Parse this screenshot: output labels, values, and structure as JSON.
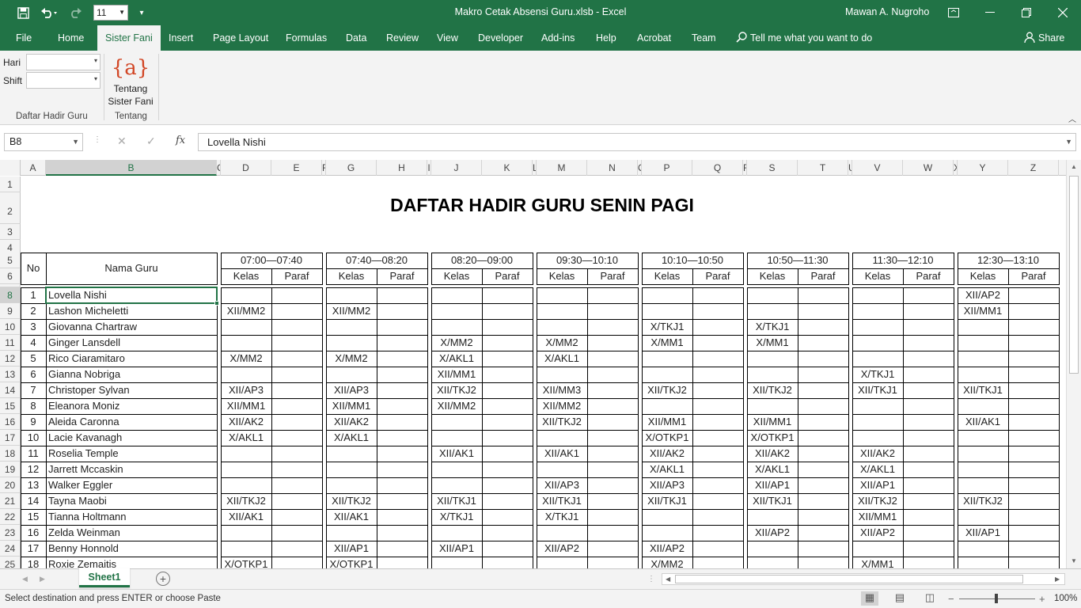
{
  "app": {
    "title": "Makro Cetak Absensi Guru.xlsb  -  Excel",
    "user": "Mawan A. Nugroho",
    "font_size": "11"
  },
  "tabs": [
    "File",
    "Home",
    "Sister Fani",
    "Insert",
    "Page Layout",
    "Formulas",
    "Data",
    "Review",
    "View",
    "Developer",
    "Add-ins",
    "Help",
    "Acrobat",
    "Team"
  ],
  "active_tab": "Sister Fani",
  "tell_me": "Tell me what you want to do",
  "share": "Share",
  "ribbon": {
    "hari_label": "Hari",
    "shift_label": "Shift",
    "group1_label": "Daftar Hadir Guru",
    "tentang_icon_text": "{a}",
    "tentang_btn_line1": "Tentang",
    "tentang_btn_line2": "Sister Fani",
    "group2_label": "Tentang"
  },
  "formula_bar": {
    "name_box": "B8",
    "fx": "fx",
    "content": "Lovella Nishi"
  },
  "columns": [
    "A",
    "B",
    "C",
    "D",
    "E",
    "F",
    "G",
    "H",
    "I",
    "J",
    "K",
    "L",
    "M",
    "N",
    "O",
    "P",
    "Q",
    "R",
    "S",
    "T",
    "U",
    "V",
    "W",
    "X",
    "Y",
    "Z"
  ],
  "selected_column": "B",
  "row_numbers": [
    "1",
    "2",
    "3",
    "4",
    "5",
    "6",
    "8",
    "9",
    "10",
    "11",
    "12",
    "13",
    "14",
    "15",
    "16",
    "17",
    "18",
    "19",
    "20",
    "21",
    "22",
    "23",
    "24",
    "25"
  ],
  "selected_row": "8",
  "sheet": {
    "title": "DAFTAR HADIR GURU SENIN PAGI",
    "header_no": "No",
    "header_nama": "Nama Guru",
    "time_slots": [
      "07:00—07:40",
      "07:40—08:20",
      "08:20—09:00",
      "09:30—10:10",
      "10:10—10:50",
      "10:50—11:30",
      "11:30—12:10",
      "12:30—13:10"
    ],
    "kelas_label": "Kelas",
    "paraf_label": "Paraf",
    "rows": [
      {
        "no": "1",
        "name": "Lovella Nishi",
        "kelas": [
          "",
          "",
          "",
          "",
          "",
          "",
          "",
          "XII/AP2"
        ]
      },
      {
        "no": "2",
        "name": "Lashon Micheletti",
        "kelas": [
          "XII/MM2",
          "XII/MM2",
          "",
          "",
          "",
          "",
          "",
          "XII/MM1"
        ]
      },
      {
        "no": "3",
        "name": "Giovanna Chartraw",
        "kelas": [
          "",
          "",
          "",
          "",
          "X/TKJ1",
          "X/TKJ1",
          "",
          ""
        ]
      },
      {
        "no": "4",
        "name": "Ginger Lansdell",
        "kelas": [
          "",
          "",
          "X/MM2",
          "X/MM2",
          "X/MM1",
          "X/MM1",
          "",
          ""
        ]
      },
      {
        "no": "5",
        "name": "Rico Ciaramitaro",
        "kelas": [
          "X/MM2",
          "X/MM2",
          "X/AKL1",
          "X/AKL1",
          "",
          "",
          "",
          ""
        ]
      },
      {
        "no": "6",
        "name": "Gianna Nobriga",
        "kelas": [
          "",
          "",
          "XII/MM1",
          "",
          "",
          "",
          "X/TKJ1",
          ""
        ]
      },
      {
        "no": "7",
        "name": "Christoper Sylvan",
        "kelas": [
          "XII/AP3",
          "XII/AP3",
          "XII/TKJ2",
          "XII/MM3",
          "XII/TKJ2",
          "XII/TKJ2",
          "XII/TKJ1",
          "XII/TKJ1"
        ]
      },
      {
        "no": "8",
        "name": "Eleanora Moniz",
        "kelas": [
          "XII/MM1",
          "XII/MM1",
          "XII/MM2",
          "XII/MM2",
          "",
          "",
          "",
          ""
        ]
      },
      {
        "no": "9",
        "name": "Aleida Caronna",
        "kelas": [
          "XII/AK2",
          "XII/AK2",
          "",
          "XII/TKJ2",
          "XII/MM1",
          "XII/MM1",
          "",
          "XII/AK1"
        ]
      },
      {
        "no": "10",
        "name": "Lacie Kavanagh",
        "kelas": [
          "X/AKL1",
          "X/AKL1",
          "",
          "",
          "X/OTKP1",
          "X/OTKP1",
          "",
          ""
        ]
      },
      {
        "no": "11",
        "name": "Roselia Temple",
        "kelas": [
          "",
          "",
          "XII/AK1",
          "XII/AK1",
          "XII/AK2",
          "XII/AK2",
          "XII/AK2",
          ""
        ]
      },
      {
        "no": "12",
        "name": "Jarrett Mccaskin",
        "kelas": [
          "",
          "",
          "",
          "",
          "X/AKL1",
          "X/AKL1",
          "X/AKL1",
          ""
        ]
      },
      {
        "no": "13",
        "name": "Walker Eggler",
        "kelas": [
          "",
          "",
          "",
          "XII/AP3",
          "XII/AP3",
          "XII/AP1",
          "XII/AP1",
          ""
        ]
      },
      {
        "no": "14",
        "name": "Tayna Maobi",
        "kelas": [
          "XII/TKJ2",
          "XII/TKJ2",
          "XII/TKJ1",
          "XII/TKJ1",
          "XII/TKJ1",
          "XII/TKJ1",
          "XII/TKJ2",
          "XII/TKJ2"
        ]
      },
      {
        "no": "15",
        "name": "Tianna Holtmann",
        "kelas": [
          "XII/AK1",
          "XII/AK1",
          "X/TKJ1",
          "X/TKJ1",
          "",
          "",
          "XII/MM1",
          ""
        ]
      },
      {
        "no": "16",
        "name": "Zelda Weinman",
        "kelas": [
          "",
          "",
          "",
          "",
          "",
          "XII/AP2",
          "XII/AP2",
          "XII/AP1"
        ]
      },
      {
        "no": "17",
        "name": "Benny Honnold",
        "kelas": [
          "",
          "XII/AP1",
          "XII/AP1",
          "XII/AP2",
          "XII/AP2",
          "",
          "",
          ""
        ]
      },
      {
        "no": "18",
        "name": "Roxie Zemaitis",
        "kelas": [
          "X/OTKP1",
          "X/OTKP1",
          "",
          "",
          "X/MM2",
          "",
          "X/MM1",
          ""
        ]
      }
    ]
  },
  "sheet_tab": "Sheet1",
  "status_text": "Select destination and press ENTER or choose Paste",
  "zoom": "100%",
  "colors": {
    "excel_green": "#217346",
    "ribbon_bg": "#f3f3f3"
  }
}
